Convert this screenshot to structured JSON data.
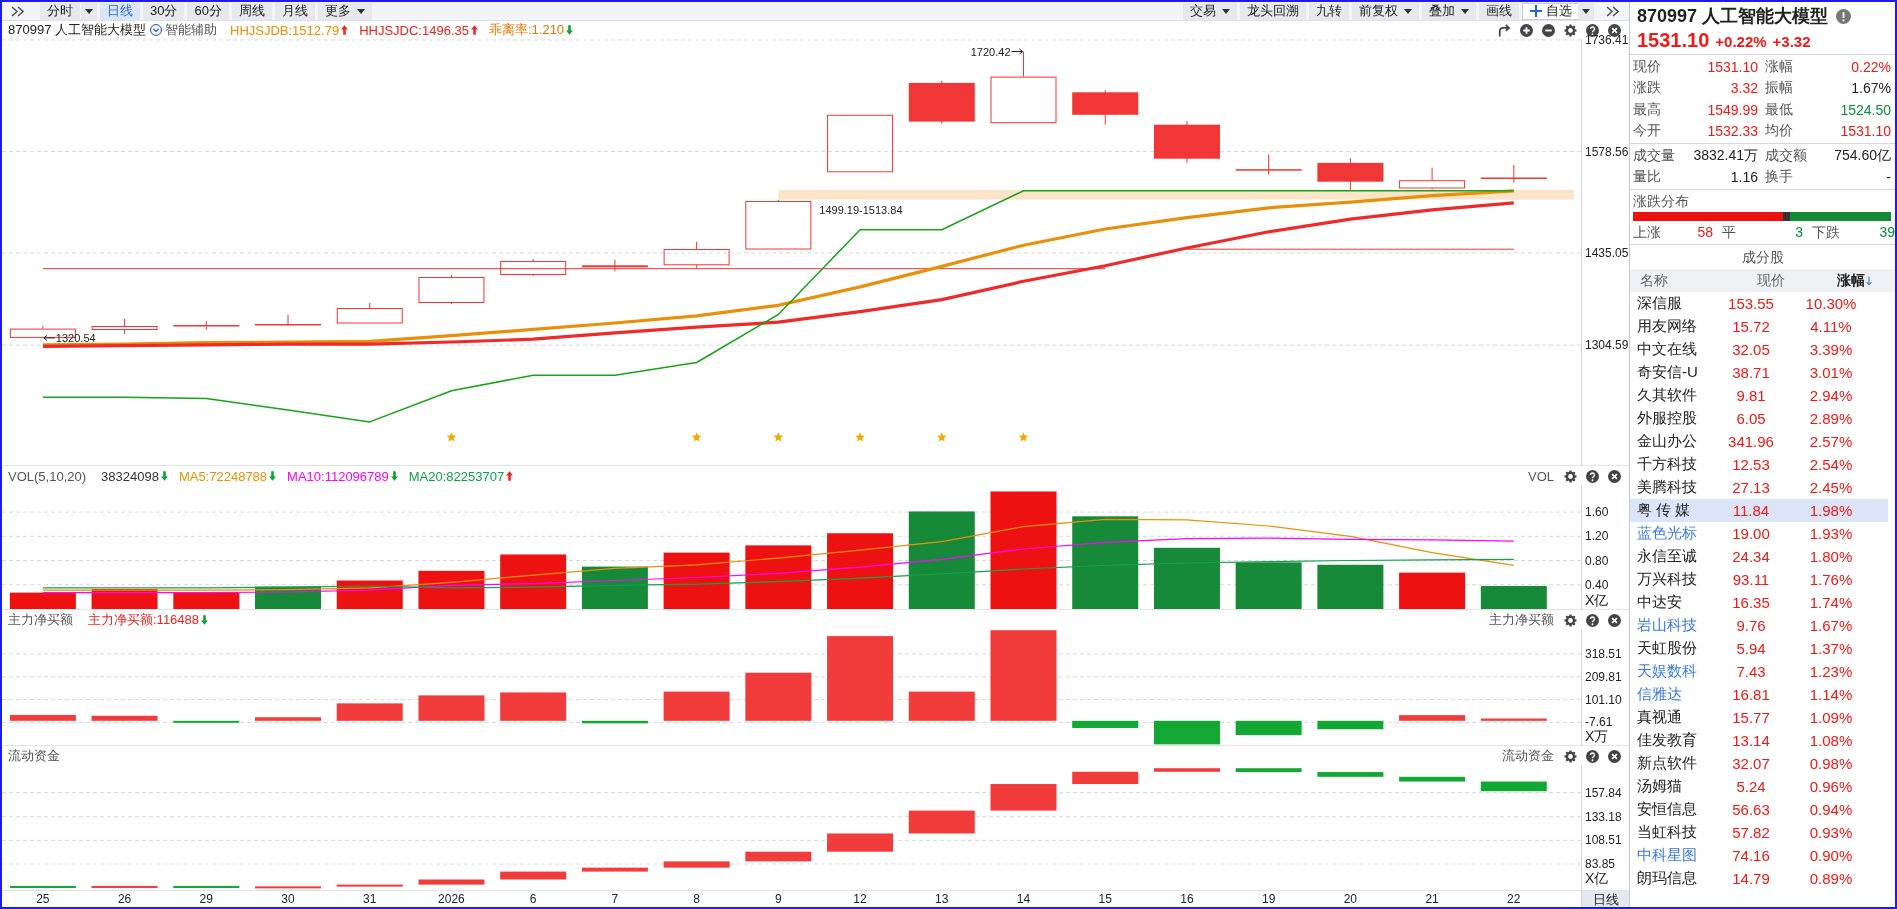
{
  "toolbar": {
    "periods": [
      {
        "label": "分时",
        "selected": false,
        "kind": "split"
      },
      {
        "label": "日线",
        "selected": true,
        "kind": "plain"
      },
      {
        "label": "30分",
        "selected": false,
        "kind": "plain"
      },
      {
        "label": "60分",
        "selected": false,
        "kind": "plain"
      },
      {
        "label": "周线",
        "selected": false,
        "kind": "plain"
      },
      {
        "label": "月线",
        "selected": false,
        "kind": "plain"
      },
      {
        "label": "更多",
        "selected": false,
        "kind": "menu"
      }
    ],
    "actions": [
      {
        "label": "交易",
        "kind": "menu"
      },
      {
        "label": "龙头回溯",
        "kind": "plain"
      },
      {
        "label": "九转",
        "kind": "plain"
      },
      {
        "label": "前复权",
        "kind": "menu"
      },
      {
        "label": "叠加",
        "kind": "menu"
      },
      {
        "label": "画线",
        "kind": "plain"
      },
      {
        "label": "自选",
        "kind": "add"
      }
    ]
  },
  "main_chart": {
    "title": "870997 人工智能大模型",
    "assist": "智能辅助",
    "legend": [
      {
        "text": "HHJSJDB:1512.79",
        "color": "#e8900a",
        "kind": "up"
      },
      {
        "text": "HHJSJDC:1496.35",
        "color": "#ee2222",
        "kind": "up"
      },
      {
        "text": "乖离率:1.210",
        "color": "#e07800",
        "kind": "down"
      }
    ],
    "band_label": "1499.19-1513.84",
    "chart_data": {
      "type": "line",
      "grid": true,
      "ylim": [
        1135,
        1737.8
      ],
      "yticks": [
        {
          "value": 1304.59,
          "label": "1304.59"
        },
        {
          "value": 1435.05,
          "label": "1435.05"
        },
        {
          "value": 1578.56,
          "label": "1578.56"
        },
        {
          "value": 1736.41,
          "label": "1736.41"
        }
      ],
      "series": [
        {
          "color": "#e8900a",
          "values": [
            1305,
            1306,
            1308,
            1309,
            1310,
            1318,
            1327,
            1336,
            1346,
            1361,
            1387,
            1416,
            1446,
            1469,
            1485,
            1499,
            1507,
            1516,
            1523
          ]
        },
        {
          "color": "#ee2a2a",
          "values": [
            1303,
            1304,
            1305,
            1306,
            1306,
            1309,
            1313,
            1322,
            1330,
            1337,
            1352,
            1369,
            1395,
            1417,
            1442,
            1465,
            1483,
            1496,
            1506
          ]
        },
        {
          "color": "#1aa31a",
          "values": [
            1231,
            1231,
            1229,
            1213,
            1196,
            1240,
            1262,
            1262,
            1280,
            1348,
            1468,
            1468,
            1523,
            1523,
            1523,
            1523,
            1523,
            1523,
            1523
          ]
        }
      ],
      "annotations": [
        "1720.42",
        "1320.54"
      ]
    }
  },
  "volume_panel": {
    "title": "VOL(5,10,20)",
    "legend": [
      {
        "text": "38324098",
        "color": "#333333",
        "kind": "down"
      },
      {
        "text": "MA5:72248788",
        "color": "#e8900a",
        "kind": "down"
      },
      {
        "text": "MA10:112096789",
        "color": "#ff00ff",
        "kind": "down"
      },
      {
        "text": "MA20:82253707",
        "color": "#12a04a",
        "kind": "up"
      }
    ],
    "side_label": "VOL",
    "chart_data": {
      "type": "bar",
      "grid": true,
      "ylabel": "X亿",
      "ylim": [
        0,
        2.03
      ],
      "yticks": [
        {
          "value": 0.4,
          "label": "0.40"
        },
        {
          "value": 0.8,
          "label": "0.80"
        },
        {
          "value": 1.2,
          "label": "1.20"
        },
        {
          "value": 1.6,
          "label": "1.60"
        }
      ],
      "series": [
        {
          "color": "#ee1111",
          "values": [
            0.27,
            0.33,
            0.28,
            null,
            0.47,
            0.63,
            0.9,
            null,
            0.93,
            1.05,
            1.25,
            null,
            1.94,
            null,
            null,
            null,
            null,
            0.6,
            null
          ]
        },
        {
          "color": "#178a3a",
          "values": [
            null,
            null,
            null,
            0.37,
            null,
            null,
            null,
            0.7,
            null,
            null,
            null,
            1.61,
            null,
            1.53,
            1.01,
            0.77,
            0.73,
            null,
            0.38
          ]
        },
        {
          "type": "line",
          "color": "#e8900a",
          "values": [
            0.31,
            0.31,
            0.31,
            0.32,
            0.35,
            0.44,
            0.56,
            0.67,
            0.73,
            0.84,
            0.97,
            1.11,
            1.36,
            1.48,
            1.47,
            1.37,
            1.2,
            0.93,
            0.72
          ]
        },
        {
          "type": "line",
          "color": "#ff00ff",
          "values": [
            0.27,
            0.27,
            0.27,
            0.28,
            0.31,
            0.39,
            0.42,
            0.47,
            0.52,
            0.59,
            0.69,
            0.82,
            0.99,
            1.1,
            1.16,
            1.17,
            1.15,
            1.14,
            1.12
          ]
        },
        {
          "type": "line",
          "color": "#12a04a",
          "values": [
            0.35,
            0.35,
            0.35,
            0.36,
            0.38,
            0.35,
            0.36,
            0.39,
            0.41,
            0.45,
            0.51,
            0.58,
            0.66,
            0.72,
            0.76,
            0.78,
            0.8,
            0.81,
            0.82
          ]
        }
      ]
    }
  },
  "net_buy_panel": {
    "title": "主力净买额",
    "legend": [
      {
        "text": "主力净买额:116488",
        "color": "#ee2222",
        "kind": "down"
      }
    ],
    "side_label": "主力净买额",
    "chart_data": {
      "type": "bar",
      "grid": true,
      "ylabel": "X万",
      "ylim": [
        -115,
        432
      ],
      "yticks": [
        {
          "value": -7.61,
          "label": "-7.61"
        },
        {
          "value": 101.1,
          "label": "101.10"
        },
        {
          "value": 209.81,
          "label": "209.81"
        },
        {
          "value": 318.51,
          "label": "318.51"
        }
      ],
      "series": [
        {
          "color": "#f23c3c",
          "values": [
            28,
            24,
            null,
            17,
            83,
            121,
            135,
            null,
            139,
            229,
            403,
            139,
            431,
            null,
            null,
            null,
            null,
            27,
            11
          ]
        },
        {
          "color": "#13a833",
          "values": [
            null,
            null,
            -3,
            null,
            null,
            null,
            null,
            -12,
            null,
            null,
            null,
            null,
            null,
            -34,
            -112,
            -68,
            -40,
            null,
            null
          ]
        }
      ]
    }
  },
  "fund_flow_panel": {
    "title": "流动资金",
    "side_label": "流动资金",
    "ticks": [
      "157.84",
      "133.18",
      "108.51",
      "83.85"
    ],
    "unit": "X亿"
  },
  "x_axis": {
    "dates": [
      "25",
      "26",
      "29",
      "30",
      "31",
      "2026",
      "6",
      "7",
      "8",
      "9",
      "12",
      "13",
      "14",
      "15",
      "16",
      "19",
      "20",
      "21",
      "22"
    ],
    "period": "日线"
  },
  "quote": {
    "title": "870997 人工智能大模型",
    "price": "1531.10",
    "change_pct": "+0.22%",
    "change": "+3.32",
    "stat_groups": [
      [
        {
          "label": "现价",
          "value": "1531.10",
          "color": "#f01818"
        },
        {
          "label": "涨幅",
          "value": "0.22%",
          "color": "#f01818"
        },
        {
          "label": "涨跌",
          "value": "3.32",
          "color": "#f01818"
        },
        {
          "label": "振幅",
          "value": "1.67%",
          "color": "#222222"
        },
        {
          "label": "最高",
          "value": "1549.99",
          "color": "#f01818"
        },
        {
          "label": "最低",
          "value": "1524.50",
          "color": "#0f8a3a"
        },
        {
          "label": "今开",
          "value": "1532.33",
          "color": "#f01818"
        },
        {
          "label": "均价",
          "value": "1531.10",
          "color": "#f01818"
        }
      ],
      [
        {
          "label": "成交量",
          "value": "3832.41万",
          "color": "#222222"
        },
        {
          "label": "成交额",
          "value": "754.60亿",
          "color": "#222222"
        },
        {
          "label": "量比",
          "value": "1.16",
          "color": "#222222"
        },
        {
          "label": "换手",
          "value": "-",
          "color": "#222222"
        }
      ]
    ],
    "breadth": {
      "title": "涨跌分布",
      "counts": [
        {
          "kind": "up",
          "label": "上涨",
          "value": "58",
          "color": "#f01818"
        },
        {
          "kind": "flat",
          "label": "平",
          "value": "3",
          "color": "#0f8a3a"
        },
        {
          "kind": "down",
          "label": "下跌",
          "value": "39",
          "color": "#0f8a3a"
        }
      ]
    },
    "constituents": {
      "title": "成分股",
      "columns": [
        {
          "label": "名称",
          "sorted": false
        },
        {
          "label": "现价",
          "sorted": false
        },
        {
          "label": "涨幅",
          "sorted": true
        }
      ],
      "rows": [
        {
          "name": "深信服",
          "price": "153.55",
          "change": "10.30%",
          "color": "#222222",
          "selected": false
        },
        {
          "name": "用友网络",
          "price": "15.72",
          "change": "4.11%",
          "color": "#222222",
          "selected": false
        },
        {
          "name": "中文在线",
          "price": "32.05",
          "change": "3.39%",
          "color": "#222222",
          "selected": false
        },
        {
          "name": "奇安信-U",
          "price": "38.71",
          "change": "3.01%",
          "color": "#222222",
          "selected": false
        },
        {
          "name": "久其软件",
          "price": "9.81",
          "change": "2.94%",
          "color": "#222222",
          "selected": false
        },
        {
          "name": "外服控股",
          "price": "6.05",
          "change": "2.89%",
          "color": "#222222",
          "selected": false
        },
        {
          "name": "金山办公",
          "price": "341.96",
          "change": "2.57%",
          "color": "#222222",
          "selected": false
        },
        {
          "name": "千方科技",
          "price": "12.53",
          "change": "2.54%",
          "color": "#222222",
          "selected": false
        },
        {
          "name": "美腾科技",
          "price": "27.13",
          "change": "2.45%",
          "color": "#222222",
          "selected": false
        },
        {
          "name": "粤 传 媒",
          "price": "11.84",
          "change": "1.98%",
          "color": "#222222",
          "selected": true
        },
        {
          "name": "蓝色光标",
          "price": "19.00",
          "change": "1.93%",
          "color": "#3c78e6",
          "selected": false
        },
        {
          "name": "永信至诚",
          "price": "24.34",
          "change": "1.80%",
          "color": "#222222",
          "selected": false
        },
        {
          "name": "万兴科技",
          "price": "93.11",
          "change": "1.76%",
          "color": "#222222",
          "selected": false
        },
        {
          "name": "中达安",
          "price": "16.35",
          "change": "1.74%",
          "color": "#222222",
          "selected": false
        },
        {
          "name": "岩山科技",
          "price": "9.76",
          "change": "1.67%",
          "color": "#3c78e6",
          "selected": false
        },
        {
          "name": "天虹股份",
          "price": "5.94",
          "change": "1.37%",
          "color": "#222222",
          "selected": false
        },
        {
          "name": "天娱数科",
          "price": "7.43",
          "change": "1.23%",
          "color": "#3c78e6",
          "selected": false
        },
        {
          "name": "信雅达",
          "price": "16.81",
          "change": "1.14%",
          "color": "#3c78e6",
          "selected": false
        },
        {
          "name": "真视通",
          "price": "15.77",
          "change": "1.09%",
          "color": "#222222",
          "selected": false
        },
        {
          "name": "佳发教育",
          "price": "13.14",
          "change": "1.08%",
          "color": "#222222",
          "selected": false
        },
        {
          "name": "新点软件",
          "price": "32.07",
          "change": "0.98%",
          "color": "#222222",
          "selected": false
        },
        {
          "name": "汤姆猫",
          "price": "5.24",
          "change": "0.96%",
          "color": "#222222",
          "selected": false
        },
        {
          "name": "安恒信息",
          "price": "56.63",
          "change": "0.94%",
          "color": "#222222",
          "selected": false
        },
        {
          "name": "当虹科技",
          "price": "57.82",
          "change": "0.93%",
          "color": "#222222",
          "selected": false
        },
        {
          "name": "中科星图",
          "price": "74.16",
          "change": "0.90%",
          "color": "#3c78e6",
          "selected": false
        },
        {
          "name": "朗玛信息",
          "price": "14.79",
          "change": "0.89%",
          "color": "#222222",
          "selected": false
        }
      ]
    }
  }
}
